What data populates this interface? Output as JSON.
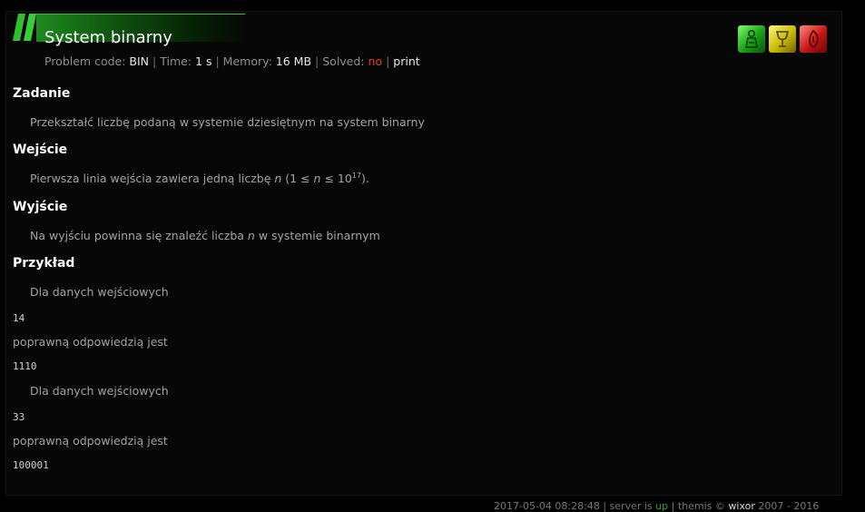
{
  "problem": {
    "title": "System binarny",
    "meta": {
      "code_label": "Problem code:",
      "code_value": "BIN",
      "time_label": "Time:",
      "time_value": "1 s",
      "memory_label": "Memory:",
      "memory_value": "16 MB",
      "solved_label": "Solved:",
      "solved_value": "no",
      "print_label": "print",
      "separator": "|"
    }
  },
  "status_icons": [
    {
      "name": "accepted-icon",
      "color": "#17a017"
    },
    {
      "name": "trophy-icon",
      "color": "#c9b800"
    },
    {
      "name": "rejected-icon",
      "color": "#c81414"
    }
  ],
  "sections": {
    "task_heading": "Zadanie",
    "task_text": "Przekształć liczbę podaną w systemie dziesiętnym na system binarny",
    "input_heading": "Wejście",
    "input_text_before": "Pierwsza linia wejścia zawiera jedną liczbę ",
    "input_var_n": "n",
    "input_range_open": " (1 ≤ ",
    "input_range_n": "n",
    "input_range_mid": " ≤ 10",
    "input_exponent": "17",
    "input_range_close": ").",
    "output_heading": "Wyjście",
    "output_text_before": "Na wyjściu powinna się znaleźć liczba ",
    "output_var_n": "n",
    "output_text_after": " w systemie binarnym",
    "example_heading": "Przykład"
  },
  "examples": [
    {
      "input_label": "Dla danych wejściowych",
      "input": "14",
      "answer_label": "poprawną odpowiedzią jest",
      "output": "1110"
    },
    {
      "input_label": "Dla danych wejściowych",
      "input": "33",
      "answer_label": "poprawną odpowiedzią jest",
      "output": "100001"
    }
  ],
  "footer": {
    "datetime": "2017-05-04 08:28:48",
    "sep1": "|",
    "server_text": "server is",
    "server_status": "up",
    "sep2": "|",
    "engine": "themis",
    "copyright": "©",
    "brand": "wixor",
    "years": "2007 - 2016"
  }
}
